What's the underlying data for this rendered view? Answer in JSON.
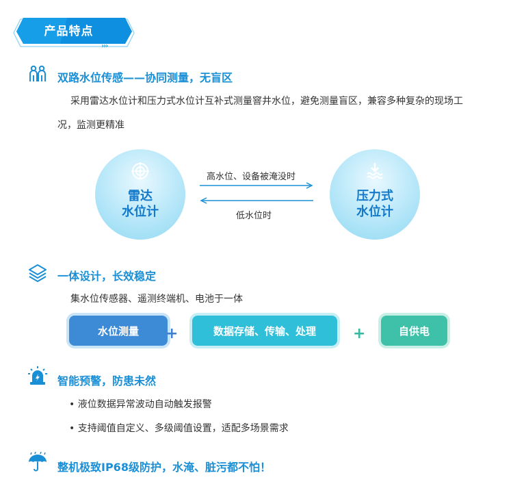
{
  "header": {
    "title": "产品特点"
  },
  "sections": {
    "s1": {
      "title": "双路水位传感——协同测量，无盲区",
      "desc_line1": "采用雷达水位计和压力式水位计互补式测量窨井水位，避免测量盲区，兼容多种复杂的现场工",
      "desc_line2": "况，监测更精准"
    },
    "s2": {
      "title": "一体设计，长效稳定",
      "desc": "集水位传感器、遥测终端机、电池于一体"
    },
    "s3": {
      "title": "智能预警，防患未然",
      "bullet1": "液位数据异常波动自动触发报警",
      "bullet2": "支持阈值自定义、多级阈值设置，适配多场景需求"
    },
    "s4": {
      "title": "整机极致IP68级防护，水淹、脏污都不怕！"
    }
  },
  "diagram": {
    "left_line1": "雷达",
    "left_line2": "水位计",
    "right_line1": "压力式",
    "right_line2": "水位计",
    "arrow_top": "高水位、设备被淹没时",
    "arrow_bottom": "低水位时"
  },
  "modules": {
    "m1": "水位测量",
    "m2": "数据存储、传输、处理",
    "m3": "自供电",
    "plus": "+"
  },
  "colors": {
    "accent": "#1a8fd6",
    "m1": "#3d8ad6",
    "m2": "#2fbfd8",
    "m3": "#3fc0a8"
  }
}
